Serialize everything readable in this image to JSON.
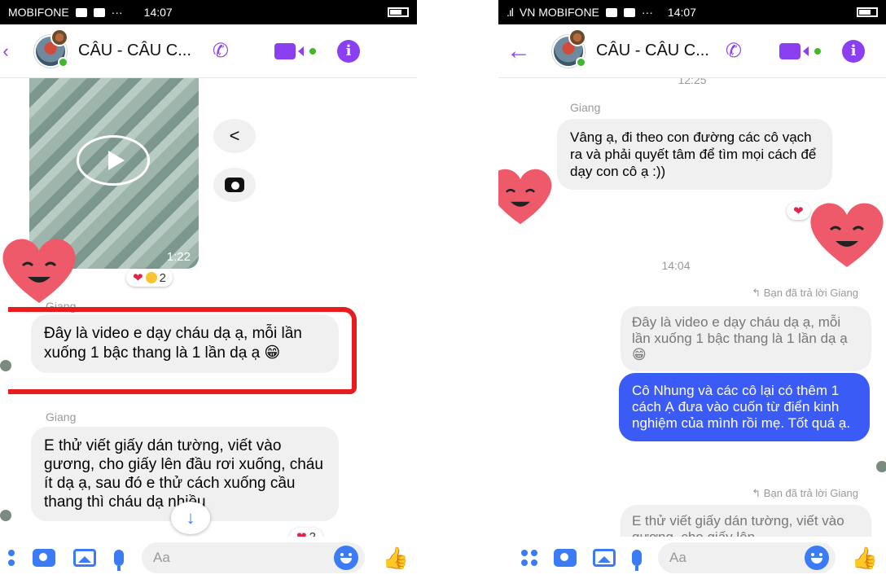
{
  "left": {
    "status": {
      "carrier": "MOBIFONE",
      "dots": "···",
      "time": "14:07"
    },
    "header": {
      "title": "CÂU - CÂU C..."
    },
    "video": {
      "duration": "1:22"
    },
    "video_reaction": {
      "count": "2"
    },
    "messages": [
      {
        "sender": "Giang",
        "text": "Đây là video e dạy cháu dạ ạ, mỗi lần xuống 1 bậc thang là 1 lần dạ ạ 😁"
      },
      {
        "sender": "Giang",
        "text": "E thử viết giấy dán tường, viết vào gương, cho giấy lên đầu rơi xuống, cháu ít dạ ạ, sau đó e thử cách xuống cầu thang thì cháu dạ nhiều"
      }
    ],
    "msg2_reaction": {
      "count": "2"
    },
    "composer": {
      "placeholder": "Aa"
    }
  },
  "right": {
    "status": {
      "carrier": "VN MOBIFONE",
      "dots": "···",
      "time": "14:07"
    },
    "header": {
      "title": "CÂU - CÂU C..."
    },
    "top_time": "12:25",
    "msg1": {
      "sender": "Giang",
      "text": "Vâng ạ, đi theo con đường các cô vạch ra và phải quyết tâm để tìm mọi cách để dạy con cô ạ :))"
    },
    "time_2": "14:04",
    "reply_note_1": "Bạn đã trả lời Giang",
    "quoted_1": "Đây là video e dạy cháu dạ ạ, mỗi lần xuống 1 bậc thang là 1 lần dạ ạ 😁",
    "my_msg": "Cô Nhung và các cô lại có thêm 1 cách Ạ đưa vào cuốn từ điển kinh nghiệm của mình rồi mẹ. Tốt quá ạ.",
    "reply_note_2": "Bạn đã trả lời Giang",
    "quoted_2": "E thử viết giấy dán tường, viết vào gương, cho giấy lên",
    "composer": {
      "placeholder": "Aa"
    }
  },
  "colors": {
    "accent": "#8a3ff0",
    "blue": "#3b7bf6",
    "my_bubble": "#3b5bf6",
    "highlight": "#e81c1c"
  }
}
